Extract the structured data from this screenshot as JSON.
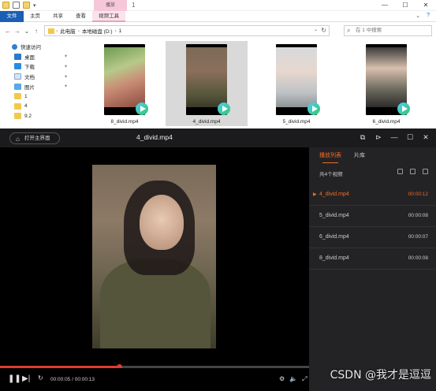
{
  "explorer": {
    "context_tab": "播放",
    "title_index": "1",
    "ribbon_tabs": [
      "文件",
      "主页",
      "共享",
      "查看",
      "视频工具"
    ],
    "path": [
      "此电脑",
      "本地磁盘 (D:)",
      "1"
    ],
    "search_placeholder": "在 1 中搜索",
    "sidebar": [
      {
        "label": "快速访问",
        "icon": "star-icon",
        "pinned": false
      },
      {
        "label": "桌面",
        "icon": "desktop-icon",
        "pinned": true
      },
      {
        "label": "下载",
        "icon": "download-icon",
        "pinned": true
      },
      {
        "label": "文档",
        "icon": "document-icon",
        "pinned": true
      },
      {
        "label": "图片",
        "icon": "picture-icon",
        "pinned": true
      },
      {
        "label": "1",
        "icon": "folder-icon",
        "pinned": false
      },
      {
        "label": "4",
        "icon": "folder-icon",
        "pinned": false
      },
      {
        "label": "9.2",
        "icon": "folder-icon",
        "pinned": false
      }
    ],
    "files": [
      {
        "name": "8_divid.mp4",
        "selected": false
      },
      {
        "name": "4_divid.mp4",
        "selected": true
      },
      {
        "name": "5_divid.mp4",
        "selected": false
      },
      {
        "name": "6_divid.mp4",
        "selected": false
      }
    ]
  },
  "player": {
    "home_label": "打开主界面",
    "title": "4_divid.mp4",
    "tabs": [
      "播放列表",
      "片库"
    ],
    "list_count": "共4个视频",
    "playlist": [
      {
        "name": "4_divid.mp4",
        "duration": "00:00:12",
        "current": true
      },
      {
        "name": "5_divid.mp4",
        "duration": "00:00:08",
        "current": false
      },
      {
        "name": "6_divid.mp4",
        "duration": "00:00:07",
        "current": false
      },
      {
        "name": "8_divid.mp4",
        "duration": "00:00:08",
        "current": false
      }
    ],
    "time": "00:00:05 / 00:00:13",
    "progress": 0.385,
    "accent": "#f46b21",
    "progress_color": "#e03c31"
  },
  "watermark": "CSDN @我才是逗逗"
}
